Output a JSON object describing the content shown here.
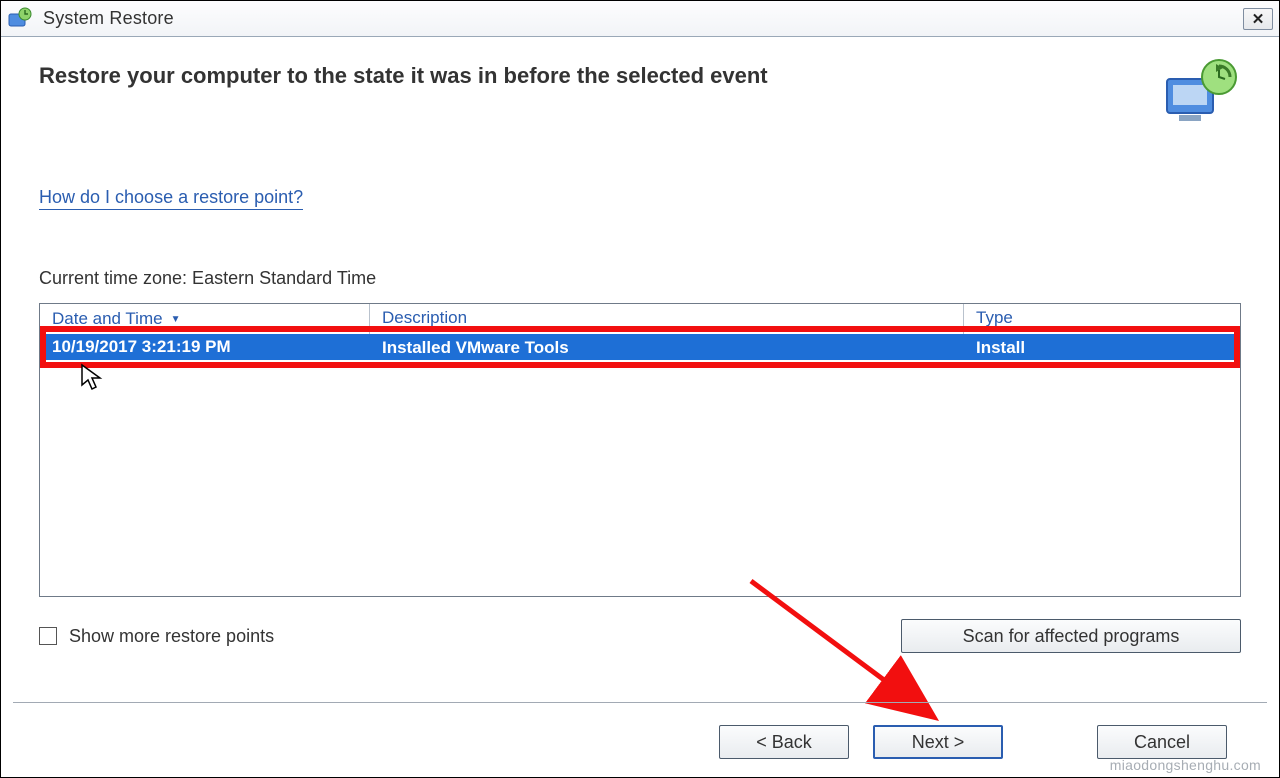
{
  "titlebar": {
    "title": "System Restore"
  },
  "header": {
    "heading": "Restore your computer to the state it was in before the selected event"
  },
  "help_link": "How do I choose a restore point?",
  "timezone_label": "Current time zone: Eastern Standard Time",
  "table": {
    "columns": {
      "date": "Date and Time",
      "desc": "Description",
      "type": "Type"
    },
    "rows": [
      {
        "date": "10/19/2017 3:21:19 PM",
        "desc": "Installed VMware Tools",
        "type": "Install",
        "selected": true
      }
    ]
  },
  "show_more_label": "Show more restore points",
  "scan_button": "Scan for affected programs",
  "footer": {
    "back": "< Back",
    "next": "Next >",
    "cancel": "Cancel"
  },
  "watermark": "miaodongshenghu.com",
  "colors": {
    "selection": "#1e6fd6",
    "highlight_border": "#f20f0f",
    "link": "#2a5db0"
  }
}
